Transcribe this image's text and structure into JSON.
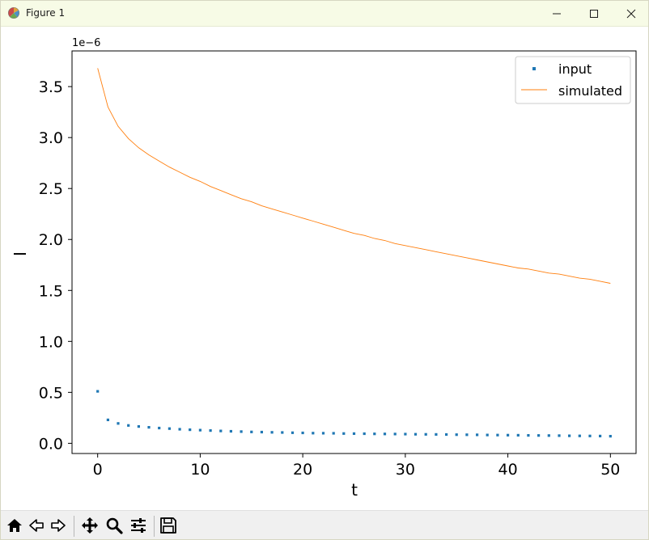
{
  "window": {
    "title": "Figure 1"
  },
  "icons": {
    "app": "matplotlib-figure-icon",
    "minimize": "minimize-icon",
    "maximize": "maximize-icon",
    "close": "close-icon"
  },
  "toolbar": {
    "buttons": [
      {
        "name": "home-icon"
      },
      {
        "name": "back-icon"
      },
      {
        "name": "forward-icon"
      },
      {
        "name": "pan-icon"
      },
      {
        "name": "zoom-icon"
      },
      {
        "name": "configure-subplots-icon"
      },
      {
        "name": "save-icon"
      }
    ]
  },
  "chart_data": {
    "type": "line",
    "title": "",
    "xlabel": "t",
    "ylabel": "I",
    "offset_label": "1e−6",
    "xlim": [
      -2.5,
      52.5
    ],
    "ylim": [
      -1e-07,
      3.85e-06
    ],
    "xticks": [
      0,
      10,
      20,
      30,
      40,
      50
    ],
    "xtick_labels": [
      "0",
      "10",
      "20",
      "30",
      "40",
      "50"
    ],
    "yticks": [
      0,
      5e-07,
      1e-06,
      1.5e-06,
      2e-06,
      2.5e-06,
      3e-06,
      3.5e-06
    ],
    "ytick_labels": [
      "0.0",
      "0.5",
      "1.0",
      "1.5",
      "2.0",
      "2.5",
      "3.0",
      "3.5"
    ],
    "grid": false,
    "legend_position": "top-right",
    "series": [
      {
        "name": "input",
        "style": "points",
        "color": "#1f77b4",
        "x": [
          0,
          1,
          2,
          3,
          4,
          5,
          6,
          7,
          8,
          9,
          10,
          11,
          12,
          13,
          14,
          15,
          16,
          17,
          18,
          19,
          20,
          21,
          22,
          23,
          24,
          25,
          26,
          27,
          28,
          29,
          30,
          31,
          32,
          33,
          34,
          35,
          36,
          37,
          38,
          39,
          40,
          41,
          42,
          43,
          44,
          45,
          46,
          47,
          48,
          49,
          50
        ],
        "y": [
          5.1e-07,
          2.3e-07,
          1.95e-07,
          1.75e-07,
          1.65e-07,
          1.57e-07,
          1.5e-07,
          1.44e-07,
          1.38e-07,
          1.33e-07,
          1.29e-07,
          1.25e-07,
          1.21e-07,
          1.18e-07,
          1.15e-07,
          1.12e-07,
          1.1e-07,
          1.08e-07,
          1.06e-07,
          1.04e-07,
          1.02e-07,
          1e-07,
          9.9e-08,
          9.8e-08,
          9.6e-08,
          9.5e-08,
          9.4e-08,
          9.3e-08,
          9.2e-08,
          9.1e-08,
          9e-08,
          8.9e-08,
          8.8e-08,
          8.7e-08,
          8.6e-08,
          8.5e-08,
          8.4e-08,
          8.3e-08,
          8.2e-08,
          8.1e-08,
          8e-08,
          7.9e-08,
          7.8e-08,
          7.7e-08,
          7.6e-08,
          7.5e-08,
          7.4e-08,
          7.3e-08,
          7.2e-08,
          7.1e-08,
          7e-08
        ]
      },
      {
        "name": "simulated",
        "style": "line",
        "color": "#ff7f0e",
        "x": [
          0,
          1,
          2,
          3,
          4,
          5,
          6,
          7,
          8,
          9,
          10,
          11,
          12,
          13,
          14,
          15,
          16,
          17,
          18,
          19,
          20,
          21,
          22,
          23,
          24,
          25,
          26,
          27,
          28,
          29,
          30,
          31,
          32,
          33,
          34,
          35,
          36,
          37,
          38,
          39,
          40,
          41,
          42,
          43,
          44,
          45,
          46,
          47,
          48,
          49,
          50
        ],
        "y": [
          3.68e-06,
          3.3e-06,
          3.11e-06,
          2.99e-06,
          2.9e-06,
          2.83e-06,
          2.77e-06,
          2.71e-06,
          2.66e-06,
          2.61e-06,
          2.57e-06,
          2.52e-06,
          2.48e-06,
          2.44e-06,
          2.4e-06,
          2.37e-06,
          2.33e-06,
          2.3e-06,
          2.27e-06,
          2.24e-06,
          2.21e-06,
          2.18e-06,
          2.15e-06,
          2.12e-06,
          2.09e-06,
          2.06e-06,
          2.04e-06,
          2.01e-06,
          1.99e-06,
          1.96e-06,
          1.94e-06,
          1.92e-06,
          1.9e-06,
          1.88e-06,
          1.86e-06,
          1.84e-06,
          1.82e-06,
          1.8e-06,
          1.78e-06,
          1.76e-06,
          1.74e-06,
          1.72e-06,
          1.71e-06,
          1.69e-06,
          1.67e-06,
          1.66e-06,
          1.64e-06,
          1.62e-06,
          1.61e-06,
          1.59e-06,
          1.57e-06
        ]
      }
    ]
  }
}
